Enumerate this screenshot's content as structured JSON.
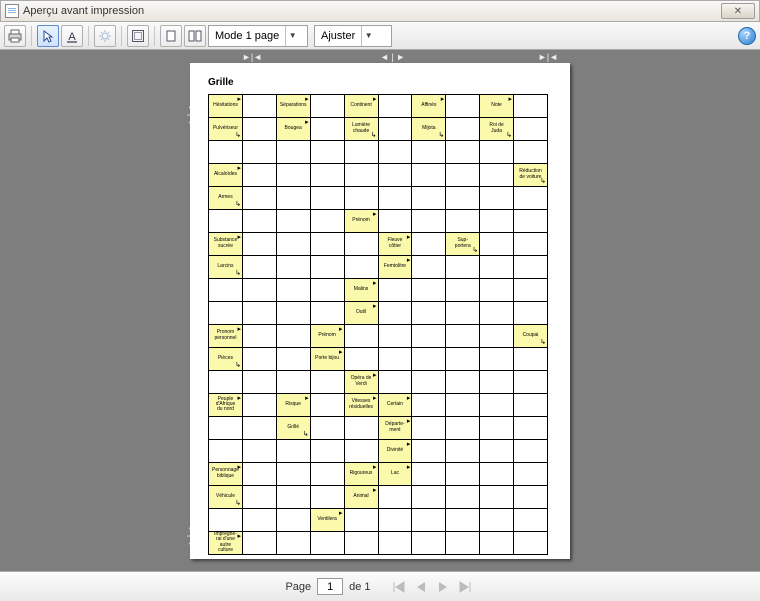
{
  "window": {
    "title": "Aperçu avant impression"
  },
  "toolbar": {
    "mode_label": "Mode 1 page",
    "zoom_label": "Ajuster"
  },
  "canvas": {
    "grid_title": "Grille",
    "cells": {
      "r0c0a": "Hésitations",
      "r0c0b": "Pulvériseur",
      "r0c2a": "Séparations",
      "r0c2b": "Bougea",
      "r0c4a": "Continent",
      "r0c4b": "Lumière\nchaude",
      "r0c6a": "Affinés",
      "r0c6b": "Mijota",
      "r0c8a": "Note",
      "r0c8b": "Roi de\nJuda",
      "r3c0a": "Alcaloïdes",
      "r3c0b": "Armes",
      "r3c9": "Réduction\nde voiture",
      "r4c4": "Prénom",
      "r5c0a": "Substance\nsucrée",
      "r5c0b": "Larcins",
      "r5c5a": "Fleuve\ncôtier",
      "r5c5b": "Femtolitre",
      "r5c7": "Sup-\nportera",
      "r6c4a": "Malins",
      "r6c4b": "Outil",
      "r7c0a": "Pronom\npersonnel",
      "r7c0b": "Pièces",
      "r7c3a": "Prénom",
      "r7c3b": "Porte bijou",
      "r7c9": "Coupai",
      "r8c4a": "Opéra de\nVerdi",
      "r8c4b": "Vitesses\nrésiduelles",
      "r9c0": "Peuple\nd'Afrique\ndu nord",
      "r9c2a": "Risque",
      "r9c2b": "Grillé",
      "r9c5a": "Certain",
      "r9c5b": "Départe-\nment",
      "r10c5a": "Divinité",
      "r10c5b": "Lac",
      "r11c0a": "Personnage\nbiblique",
      "r11c0b": "Véhicule",
      "r11c4a": "Rigoureux",
      "r11c4b": "Animal",
      "r12c3": "Ventilera",
      "r13c0": "Imprègne-\nrai d'une\nautre\nculture"
    }
  },
  "pager": {
    "page_label": "Page",
    "page_value": "1",
    "of_label": "de 1"
  }
}
